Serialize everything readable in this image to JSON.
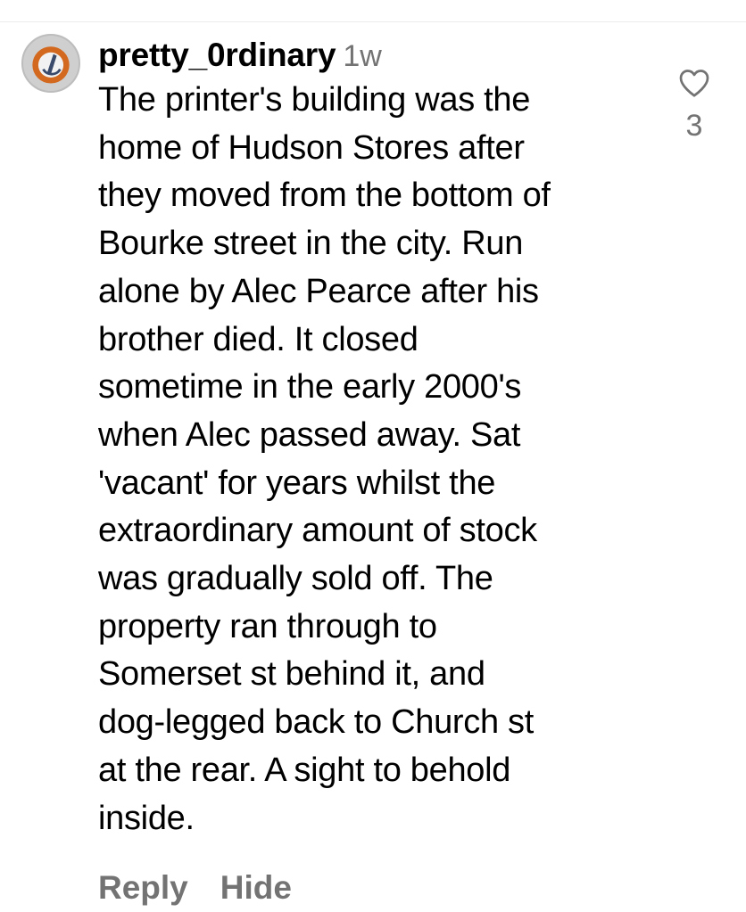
{
  "comment": {
    "username": "pretty_0rdinary",
    "timestamp": "1w",
    "text_lines": [
      "The printer's building was the",
      "home of Hudson Stores after",
      "they moved from the bottom of",
      "Bourke street in the city. Run",
      "alone by Alec Pearce after his",
      "brother died. It closed",
      "sometime in the early 2000's",
      "when Alec passed away. Sat",
      "'vacant' for years whilst the",
      "extraordinary amount of stock",
      "was gradually sold off. The",
      "property ran through to",
      "Somerset st behind it, and",
      "dog-legged back to Church st",
      "at the rear. A sight to behold",
      "inside."
    ],
    "like_count": "3",
    "like_icon": "heart-outline-icon",
    "actions": {
      "reply_label": "Reply",
      "hide_label": "Hide"
    }
  },
  "colors": {
    "text_primary": "#000000",
    "text_secondary": "#737373",
    "divider": "#ececec"
  }
}
